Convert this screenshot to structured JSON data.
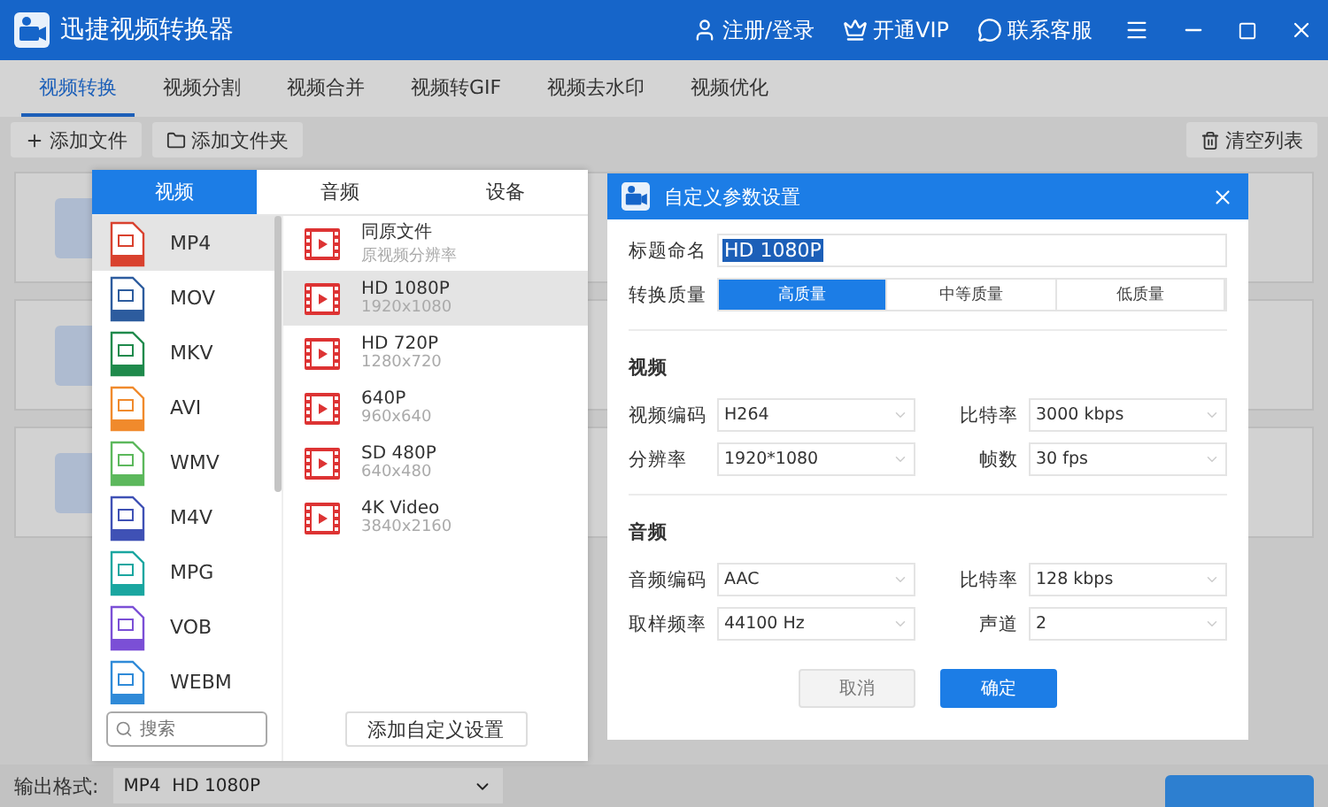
{
  "window": {
    "title": "迅捷视频转换器",
    "actions": [
      {
        "kind": "user",
        "label": "注册/登录"
      },
      {
        "kind": "vip",
        "label": "开通VIP"
      },
      {
        "kind": "chat",
        "label": "联系客服"
      }
    ]
  },
  "tabs": [
    {
      "label": "视频转换",
      "selected": true
    },
    {
      "label": "视频分割",
      "selected": false
    },
    {
      "label": "视频合并",
      "selected": false
    },
    {
      "label": "视频转GIF",
      "selected": false
    },
    {
      "label": "视频去水印",
      "selected": false
    },
    {
      "label": "视频优化",
      "selected": false
    }
  ],
  "toolbar": {
    "add_file": "添加文件",
    "add_folder": "添加文件夹",
    "clear_list": "清空列表"
  },
  "output": {
    "label": "输出格式:",
    "value": "MP4  HD 1080P"
  },
  "format_popup": {
    "tabs": [
      {
        "label": "视频",
        "selected": true
      },
      {
        "label": "音频",
        "selected": false
      },
      {
        "label": "设备",
        "selected": false
      }
    ],
    "formats": [
      {
        "name": "MP4",
        "color": "#d9412e",
        "selected": true
      },
      {
        "name": "MOV",
        "color": "#2d5c9e",
        "selected": false
      },
      {
        "name": "MKV",
        "color": "#1f8a4c",
        "selected": false
      },
      {
        "name": "AVI",
        "color": "#f08a2c",
        "selected": false
      },
      {
        "name": "WMV",
        "color": "#5cb85c",
        "selected": false
      },
      {
        "name": "M4V",
        "color": "#3f51b5",
        "selected": false
      },
      {
        "name": "MPG",
        "color": "#1aa6a0",
        "selected": false
      },
      {
        "name": "VOB",
        "color": "#7b4fd6",
        "selected": false
      },
      {
        "name": "WEBM",
        "color": "#2f8ad8",
        "selected": false
      }
    ],
    "search": {
      "placeholder": "搜索"
    },
    "presets": [
      {
        "name": "同原文件",
        "detail": "原视频分辨率",
        "selected": false
      },
      {
        "name": "HD 1080P",
        "detail": "1920x1080",
        "selected": true
      },
      {
        "name": "HD 720P",
        "detail": "1280x720",
        "selected": false
      },
      {
        "name": "640P",
        "detail": "960x640",
        "selected": false
      },
      {
        "name": "SD 480P",
        "detail": "640x480",
        "selected": false
      },
      {
        "name": "4K Video",
        "detail": "3840x2160",
        "selected": false
      }
    ],
    "add_custom": "添加自定义设置"
  },
  "dialog": {
    "title": "自定义参数设置",
    "name_label": "标题命名",
    "name_value": "HD 1080P",
    "quality_label": "转换质量",
    "quality": [
      {
        "label": "高质量",
        "selected": true
      },
      {
        "label": "中等质量",
        "selected": false
      },
      {
        "label": "低质量",
        "selected": false
      }
    ],
    "sections": [
      {
        "title": "视频",
        "rows": [
          [
            {
              "label": "视频编码",
              "value": "H264"
            },
            {
              "label": "比特率",
              "value": "3000 kbps"
            }
          ],
          [
            {
              "label": "分辨率",
              "value": "1920*1080"
            },
            {
              "label": "帧数",
              "value": "30 fps"
            }
          ]
        ]
      },
      {
        "title": "音频",
        "rows": [
          [
            {
              "label": "音频编码",
              "value": "AAC"
            },
            {
              "label": "比特率",
              "value": "128 kbps"
            }
          ],
          [
            {
              "label": "取样频率",
              "value": "44100 Hz"
            },
            {
              "label": "声道",
              "value": "2"
            }
          ]
        ]
      }
    ],
    "cancel": "取消",
    "confirm": "确定"
  }
}
